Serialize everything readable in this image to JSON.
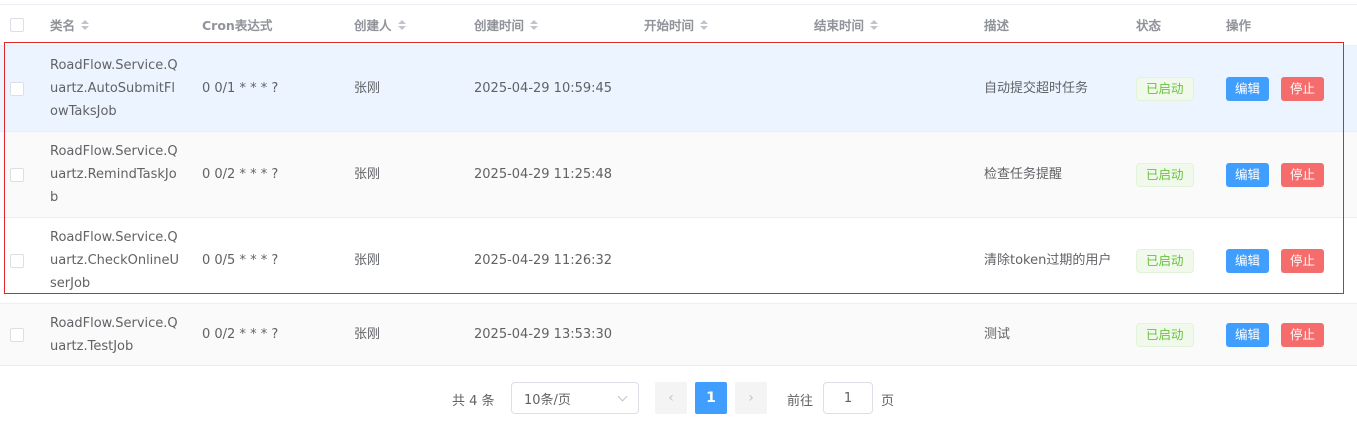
{
  "header": {
    "class_name": "类名",
    "cron": "Cron表达式",
    "creator": "创建人",
    "create_time": "创建时间",
    "start_time": "开始时间",
    "end_time": "结束时间",
    "description": "描述",
    "status": "状态",
    "actions": "操作"
  },
  "rows": [
    {
      "class_name": "RoadFlow.Service.Quartz.AutoSubmitFlowTaksJob",
      "cron": "0 0/1 * * * ?",
      "creator": "张刚",
      "create_time": "2025-04-29 10:59:45",
      "start_time": "",
      "end_time": "",
      "description": "自动提交超时任务",
      "status": "已启动",
      "edit": "编辑",
      "stop": "停止"
    },
    {
      "class_name": "RoadFlow.Service.Quartz.RemindTaskJob",
      "cron": "0 0/2 * * * ?",
      "creator": "张刚",
      "create_time": "2025-04-29 11:25:48",
      "start_time": "",
      "end_time": "",
      "description": "检查任务提醒",
      "status": "已启动",
      "edit": "编辑",
      "stop": "停止"
    },
    {
      "class_name": "RoadFlow.Service.Quartz.CheckOnlineUserJob",
      "cron": "0 0/5 * * * ?",
      "creator": "张刚",
      "create_time": "2025-04-29 11:26:32",
      "start_time": "",
      "end_time": "",
      "description": "清除token过期的用户",
      "status": "已启动",
      "edit": "编辑",
      "stop": "停止"
    },
    {
      "class_name": "RoadFlow.Service.Quartz.TestJob",
      "cron": "0 0/2 * * * ?",
      "creator": "张刚",
      "create_time": "2025-04-29 13:53:30",
      "start_time": "",
      "end_time": "",
      "description": "测试",
      "status": "已启动",
      "edit": "编辑",
      "stop": "停止"
    }
  ],
  "pagination": {
    "total": "共 4 条",
    "page_size": "10条/页",
    "prev": "‹",
    "current": "1",
    "next": "›",
    "goto_label": "前往",
    "goto_value": "1",
    "page_label": "页"
  },
  "colors": {
    "primary": "#409eff",
    "danger": "#f56c6c",
    "success": "#67c23a",
    "highlight_border": "#e0252b"
  }
}
